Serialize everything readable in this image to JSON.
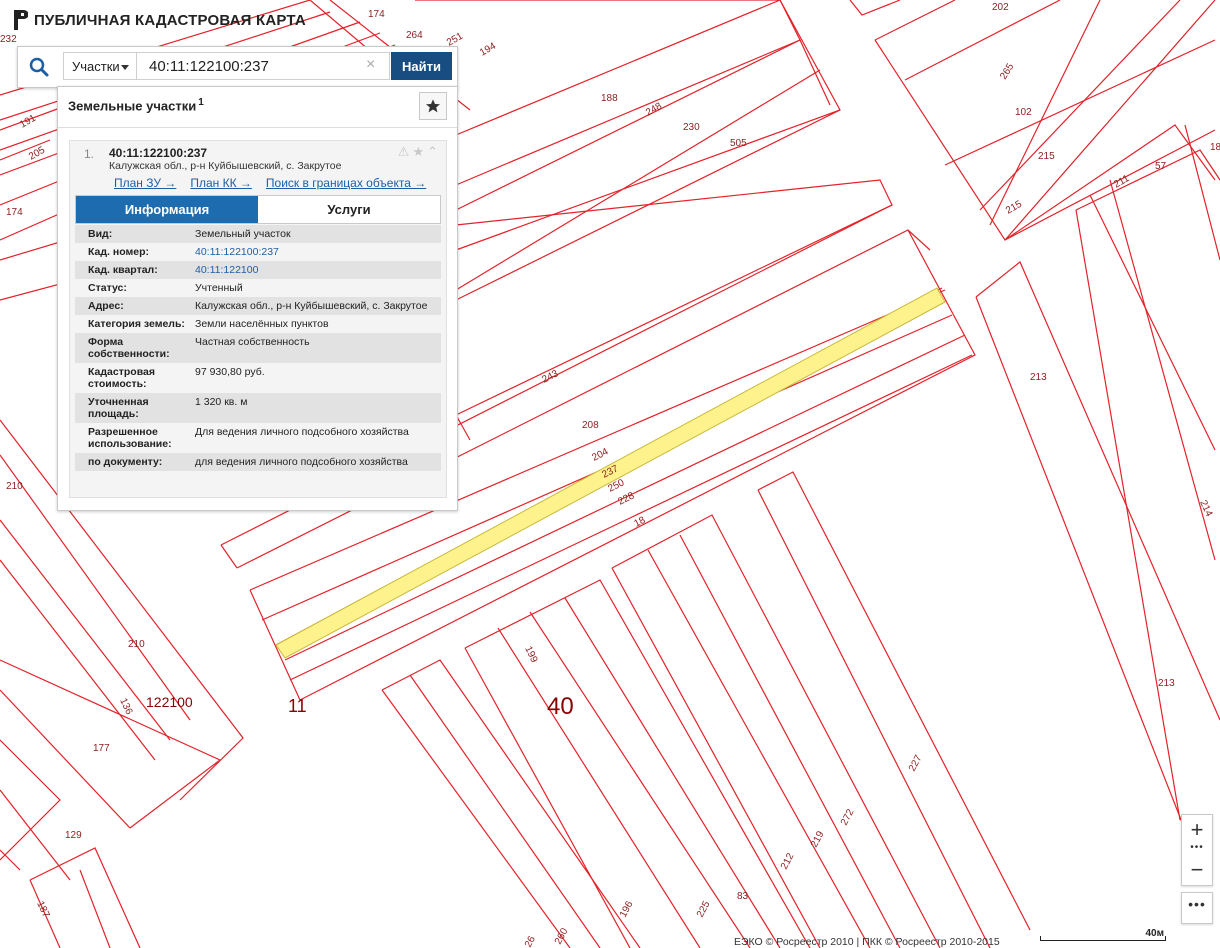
{
  "app": {
    "title": "ПУБЛИЧНАЯ КАДАСТРОВАЯ КАРТА"
  },
  "search": {
    "scope": "Участки",
    "query": "40:11:122100:237",
    "button": "Найти",
    "clear": "×"
  },
  "panel": {
    "title": "Земельные участки",
    "count": "1",
    "result": {
      "index": "1.",
      "cad_number": "40:11:122100:237",
      "address": "Калужская обл., р-н Куйбышевский, с. Закрутое",
      "links": [
        "План ЗУ →",
        "План КК →",
        "Поиск в границах объекта →"
      ],
      "tabs": [
        "Информация",
        "Услуги"
      ],
      "properties": [
        {
          "label": "Вид:",
          "value": "Земельный участок"
        },
        {
          "label": "Кад. номер:",
          "value": "40:11:122100:237",
          "link": true
        },
        {
          "label": "Кад. квартал:",
          "value": "40:11:122100",
          "link": true
        },
        {
          "label": "Статус:",
          "value": "Учтенный"
        },
        {
          "label": "Адрес:",
          "value": "Калужская обл., р-н Куйбышевский, с. Закрутое"
        },
        {
          "label": "Категория земель:",
          "value": "Земли населённых пунктов"
        },
        {
          "label": "Форма собственности:",
          "value": "Частная собственность"
        },
        {
          "label": "Кадастровая стоимость:",
          "value": "97 930,80 руб."
        },
        {
          "label": "Уточненная площадь:",
          "value": "1 320 кв. м"
        },
        {
          "label": "Разрешенное использование:",
          "value": "Для ведения личного подсобного хозяйства"
        },
        {
          "label": "по документу:",
          "value": "для ведения личного подсобного хозяйства"
        }
      ]
    }
  },
  "map": {
    "parcel_labels": [
      "174",
      "264",
      "251",
      "194",
      "232",
      "191",
      "205",
      "174",
      "188",
      "248",
      "230",
      "505",
      "202",
      "265",
      "102",
      "215",
      "215",
      "57",
      "18",
      "211",
      "243",
      "208",
      "204",
      "237",
      "250",
      "228",
      "18",
      "213",
      "214",
      "210",
      "210",
      "136",
      "177",
      "129",
      "187",
      "199",
      "83",
      "196",
      "225",
      "212",
      "219",
      "272",
      "227",
      "213",
      "26",
      "260"
    ],
    "quarter_labels": [
      "122100",
      "11",
      "40"
    ],
    "highlighted_parcel": "237",
    "colors": {
      "boundary": "#e3222a",
      "highlight_fill": "#fdf28c",
      "highlight_stroke": "#c9b93a",
      "label": "#8a1e1e",
      "quarter": "#8a0000"
    }
  },
  "controls": {
    "zoom_in": "+",
    "zoom_out": "−",
    "zoom_sep": "•••",
    "more": "•••",
    "copyright": "ЕЭКО © Росреестр 2010 | ПКК © Росреестр 2010-2015",
    "scale": "40м"
  }
}
